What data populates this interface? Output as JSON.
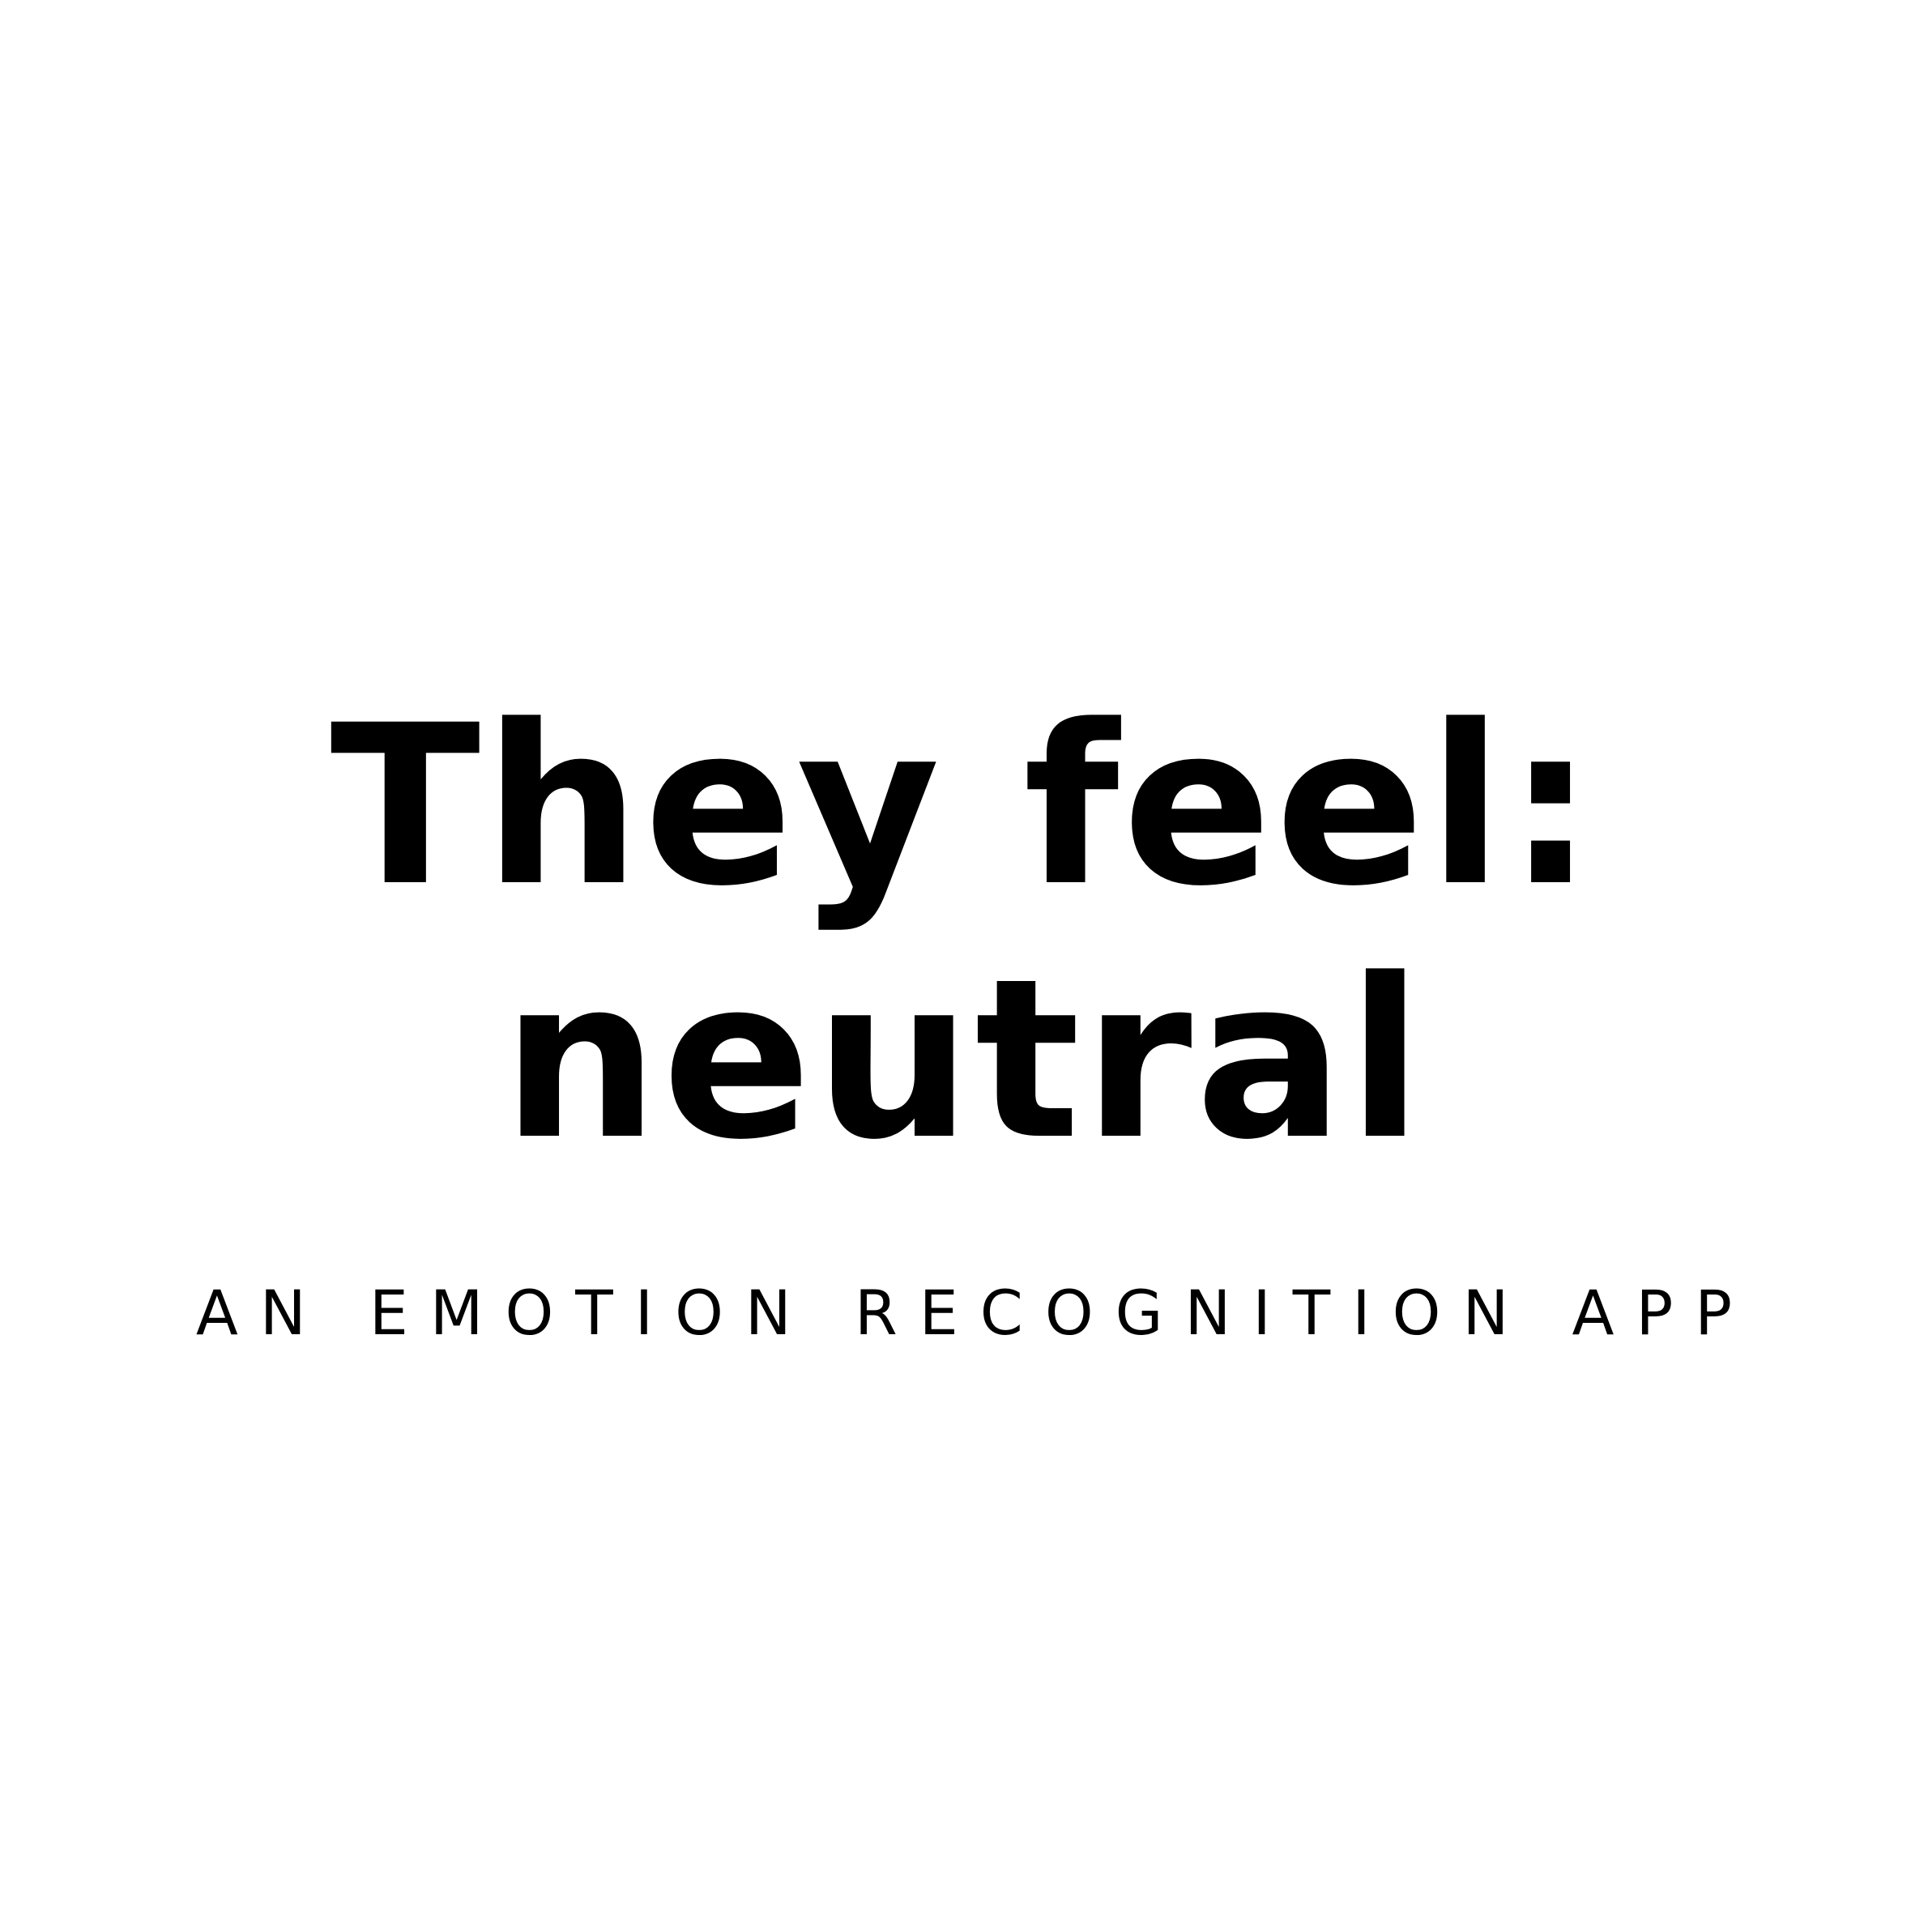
{
  "headline": {
    "line1": "They feel:",
    "line2": "neutral"
  },
  "subtitle": "AN EMOTION RECOGNITION APP",
  "colors": {
    "background": "#ffffff",
    "text": "#000000"
  }
}
